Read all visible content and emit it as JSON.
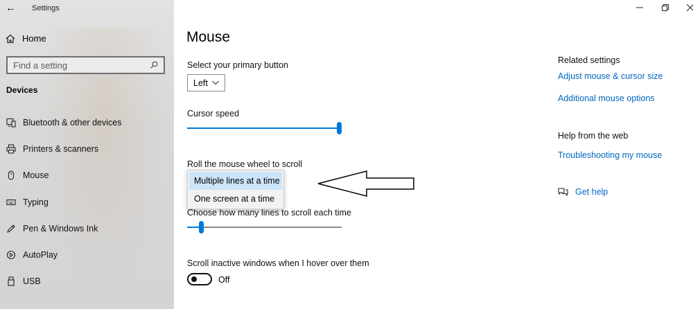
{
  "window": {
    "title": "Settings",
    "controls": {
      "minimize_icon": "minimize-icon",
      "restore_icon": "restore-icon",
      "close_icon": "close-icon"
    }
  },
  "sidebar": {
    "home_label": "Home",
    "search_placeholder": "Find a setting",
    "section_heading": "Devices",
    "items": [
      {
        "label": "Bluetooth & other devices",
        "icon": "bluetooth-devices-icon"
      },
      {
        "label": "Printers & scanners",
        "icon": "printer-icon"
      },
      {
        "label": "Mouse",
        "icon": "mouse-icon"
      },
      {
        "label": "Typing",
        "icon": "keyboard-icon"
      },
      {
        "label": "Pen & Windows Ink",
        "icon": "pen-icon"
      },
      {
        "label": "AutoPlay",
        "icon": "autoplay-icon"
      },
      {
        "label": "USB",
        "icon": "usb-icon"
      }
    ]
  },
  "main": {
    "title": "Mouse",
    "primary_button": {
      "label": "Select your primary button",
      "value": "Left"
    },
    "cursor_speed": {
      "label": "Cursor speed",
      "value_fraction": 1.0
    },
    "wheel_scroll": {
      "label": "Roll the mouse wheel to scroll",
      "options": [
        "Multiple lines at a time",
        "One screen at a time"
      ],
      "selected": "Multiple lines at a time"
    },
    "lines_to_scroll": {
      "label": "Choose how many lines to scroll each time",
      "value_fraction": 0.08
    },
    "scroll_inactive": {
      "label": "Scroll inactive windows when I hover over them",
      "state": "Off"
    }
  },
  "related": {
    "heading": "Related settings",
    "links": [
      "Adjust mouse & cursor size",
      "Additional mouse options"
    ],
    "help_heading": "Help from the web",
    "help_links": [
      "Troubleshooting my mouse"
    ],
    "get_help": "Get help"
  },
  "colors": {
    "accent": "#0078d7",
    "link": "#0067c0",
    "selection": "#cce4f7"
  }
}
